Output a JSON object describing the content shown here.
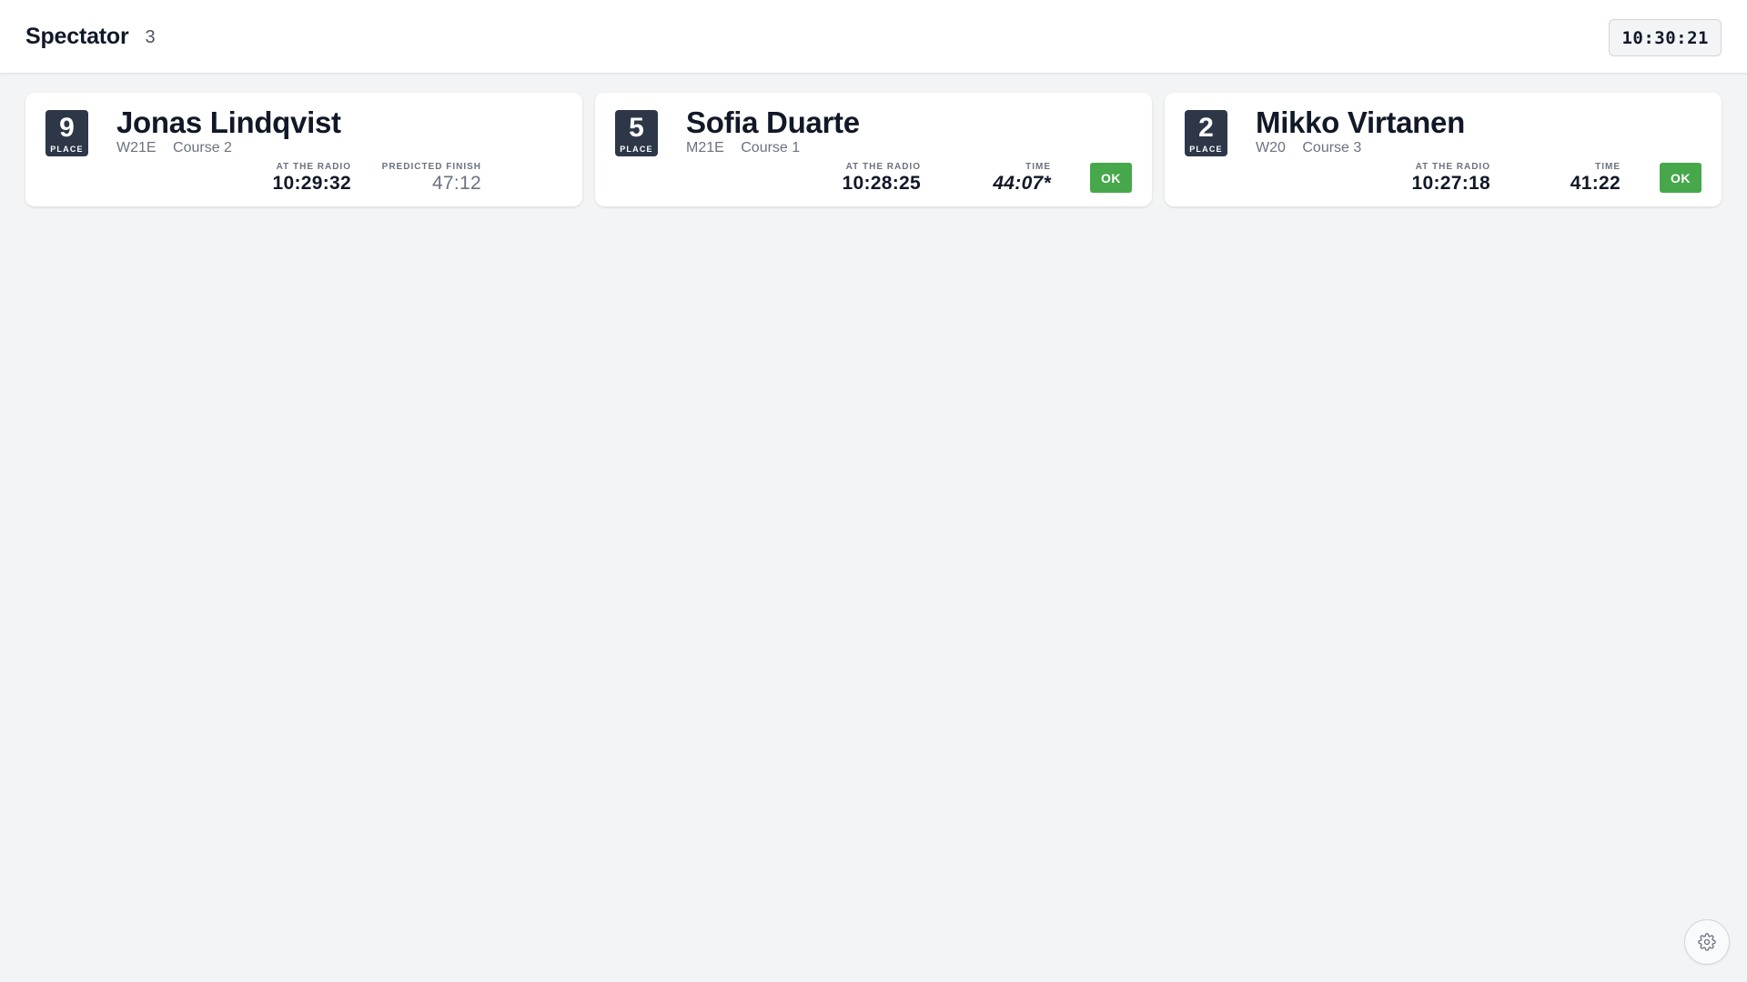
{
  "header": {
    "title": "Spectator",
    "count": "3",
    "clock": "10:30:21"
  },
  "cards": [
    {
      "place": "9",
      "place_label": "PLACE",
      "name": "Jonas Lindqvist",
      "class": "W21E",
      "course": "Course 2",
      "radio_label": "AT THE RADIO",
      "radio_time": "10:29:32",
      "time_label": "PREDICTED FINISH",
      "time_value": "47:12"
    },
    {
      "place": "5",
      "place_label": "PLACE",
      "name": "Sofia Duarte",
      "class": "M21E",
      "course": "Course 1",
      "radio_label": "AT THE RADIO",
      "radio_time": "10:28:25",
      "time_label": "TIME",
      "time_value": "44:07*",
      "status": "OK"
    },
    {
      "place": "2",
      "place_label": "PLACE",
      "name": "Mikko Virtanen",
      "class": "W20",
      "course": "Course 3",
      "radio_label": "AT THE RADIO",
      "radio_time": "10:27:18",
      "time_label": "TIME",
      "time_value": "41:22",
      "status": "OK"
    }
  ],
  "icons": {
    "settings": "gear-icon"
  },
  "colors": {
    "badge_bg": "#2d3748",
    "ok_green": "#46a84a",
    "background": "#f3f4f6"
  }
}
